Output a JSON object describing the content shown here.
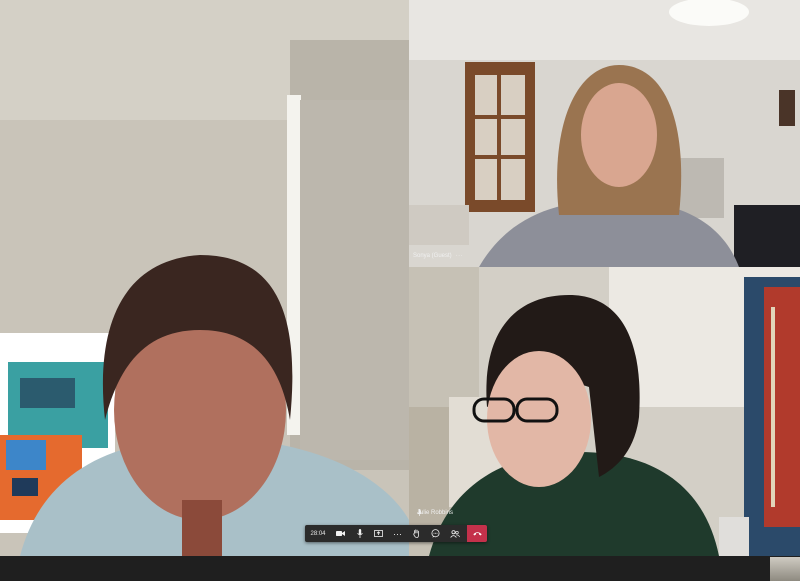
{
  "participants": [
    {
      "id": "main",
      "name": ""
    },
    {
      "id": "top-right",
      "name": "Sonya (Guest)"
    },
    {
      "id": "bottom-right",
      "name": "Julie Robbins"
    }
  ],
  "more_glyph": "···",
  "controls": {
    "timer": "28:04",
    "buttons": [
      {
        "name": "camera",
        "icon": "camera-icon"
      },
      {
        "name": "microphone",
        "icon": "microphone-icon"
      },
      {
        "name": "share",
        "icon": "share-screen-icon"
      },
      {
        "name": "more",
        "icon": "more-icon",
        "label": "···"
      },
      {
        "name": "raise-hand",
        "icon": "hand-icon"
      },
      {
        "name": "chat",
        "icon": "chat-icon"
      },
      {
        "name": "participants",
        "icon": "people-icon"
      },
      {
        "name": "hang-up",
        "icon": "hang-up-icon",
        "color": "#c4314b"
      }
    ]
  }
}
